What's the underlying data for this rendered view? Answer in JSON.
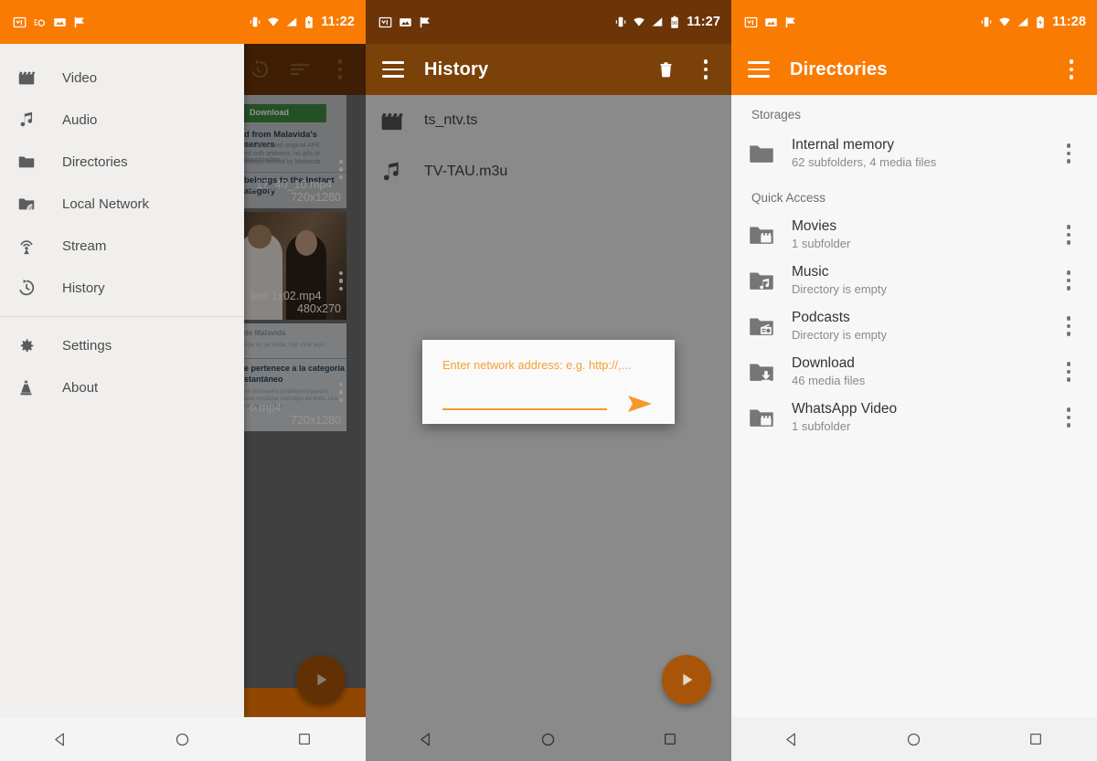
{
  "theme": {
    "orange": "#fa7b02",
    "orange_dim": "#6b3508",
    "fab_orange": "#a8550a",
    "fab_orange_bright": "#f08b10",
    "drawer_bg": "#f0efed",
    "list_bg": "#f7f7f7",
    "text_dark": "#333333",
    "text_sub": "#8a8a8a",
    "hint_orange": "#f5a02e"
  },
  "panel1": {
    "status": {
      "time": "11:22",
      "left_icons": [
        "gmail-icon",
        "camera-settings-icon",
        "photos-icon",
        "flag-check-icon"
      ],
      "right_icons": [
        "vibrate-icon",
        "wifi-icon",
        "signal-icon",
        "battery-charging-icon"
      ]
    },
    "toolbar": {
      "actions": [
        "history-refresh-icon",
        "sort-icon",
        "overflow-menu-icon"
      ]
    },
    "drawer": {
      "items": [
        {
          "label": "Video",
          "icon": "movie-clapper-icon"
        },
        {
          "label": "Audio",
          "icon": "music-note-icon"
        },
        {
          "label": "Directories",
          "icon": "folder-icon"
        },
        {
          "label": "Local Network",
          "icon": "folder-network-icon"
        },
        {
          "label": "Stream",
          "icon": "stream-antenna-icon"
        },
        {
          "label": "History",
          "icon": "history-clock-icon"
        }
      ],
      "footer_items": [
        {
          "label": "Settings",
          "icon": "gear-icon"
        },
        {
          "label": "About",
          "icon": "vlc-cone-icon"
        }
      ]
    },
    "thumbnails": [
      {
        "filename": "_17_40_10.mp4",
        "dimensions": "720x1280",
        "caption_lines": [
          "Download",
          "d from Malavida's servers",
          "belongs to the Instant",
          "ategory"
        ]
      },
      {
        "filename": "ase 1x02.mp4",
        "dimensions": "480x270",
        "caption_lines": []
      },
      {
        "filename": "o.mp4",
        "dimensions": "720x1280",
        "caption_lines": [
          "de Malavida",
          "e pertenece a la categoria",
          "stantaneo"
        ]
      }
    ],
    "fab": {
      "icon": "play-icon"
    },
    "navbar": {
      "buttons": [
        "back-icon",
        "home-icon",
        "recents-icon"
      ]
    }
  },
  "panel2": {
    "status": {
      "time": "11:27",
      "left_icons": [
        "gmail-icon",
        "photos-icon",
        "flag-check-icon"
      ],
      "right_icons": [
        "vibrate-icon",
        "wifi-icon",
        "signal-icon",
        "battery-icon"
      ]
    },
    "toolbar": {
      "title": "History",
      "menu_icon": "hamburger-icon",
      "actions": [
        "delete-trash-icon",
        "overflow-menu-icon"
      ]
    },
    "list": [
      {
        "title": "ts_ntv.ts",
        "icon": "movie-clapper-icon"
      },
      {
        "title": "TV-TAU.m3u",
        "icon": "music-note-icon"
      }
    ],
    "dialog": {
      "hint": "Enter network address: e.g. http://,...",
      "input_value": "",
      "send_icon": "send-arrow-icon"
    },
    "fab": {
      "icon": "play-icon"
    },
    "navbar": {
      "buttons": [
        "back-icon",
        "home-icon",
        "recents-icon"
      ]
    }
  },
  "panel3": {
    "status": {
      "time": "11:28",
      "left_icons": [
        "gmail-icon",
        "photos-icon",
        "flag-check-icon"
      ],
      "right_icons": [
        "vibrate-icon",
        "wifi-icon",
        "signal-icon",
        "battery-charging-icon"
      ]
    },
    "toolbar": {
      "title": "Directories",
      "menu_icon": "hamburger-icon",
      "actions": [
        "overflow-menu-icon"
      ]
    },
    "sections": [
      {
        "label": "Storages",
        "items": [
          {
            "title": "Internal memory",
            "subtitle": "62 subfolders, 4 media files",
            "icon": "folder-icon"
          }
        ]
      },
      {
        "label": "Quick Access",
        "items": [
          {
            "title": "Movies",
            "subtitle": "1 subfolder",
            "icon": "folder-movie-icon"
          },
          {
            "title": "Music",
            "subtitle": "Directory is empty",
            "icon": "folder-music-icon"
          },
          {
            "title": "Podcasts",
            "subtitle": "Directory is empty",
            "icon": "folder-podcast-icon"
          },
          {
            "title": "Download",
            "subtitle": "46 media files",
            "icon": "folder-download-icon"
          },
          {
            "title": "WhatsApp Video",
            "subtitle": "1 subfolder",
            "icon": "folder-movie-icon"
          }
        ]
      }
    ],
    "navbar": {
      "buttons": [
        "back-icon",
        "home-icon",
        "recents-icon"
      ]
    }
  }
}
